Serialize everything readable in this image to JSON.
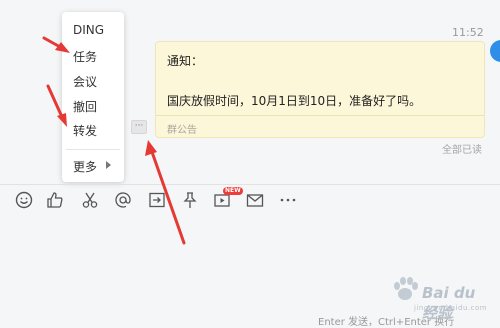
{
  "chat": {
    "timestamp": "11:52",
    "message": {
      "title": "通知：",
      "body": "国庆放假时间，10月1日到10日，准备好了吗。",
      "footer": "群公告"
    },
    "read_status": "全部已读",
    "more_button": "···"
  },
  "context_menu": {
    "items": [
      "DING",
      "任务",
      "会议",
      "撤回",
      "转发"
    ],
    "more_label": "更多"
  },
  "toolbar": {
    "tools": [
      "emoji-icon",
      "like-icon",
      "scissors-icon",
      "mention-icon",
      "screen-share-icon",
      "pin-icon",
      "video-icon",
      "mail-icon",
      "more-icon"
    ],
    "new_badge": "NEW"
  },
  "input": {
    "send_hint": "Enter 发送，Ctrl+Enter 换行"
  },
  "watermark": {
    "text": "Bai du 经验",
    "sub": "jingyan.baidu.com"
  },
  "colors": {
    "bubble_bg": "#fdf7d9",
    "arrow": "#e53935",
    "accent": "#2f8fe8"
  }
}
